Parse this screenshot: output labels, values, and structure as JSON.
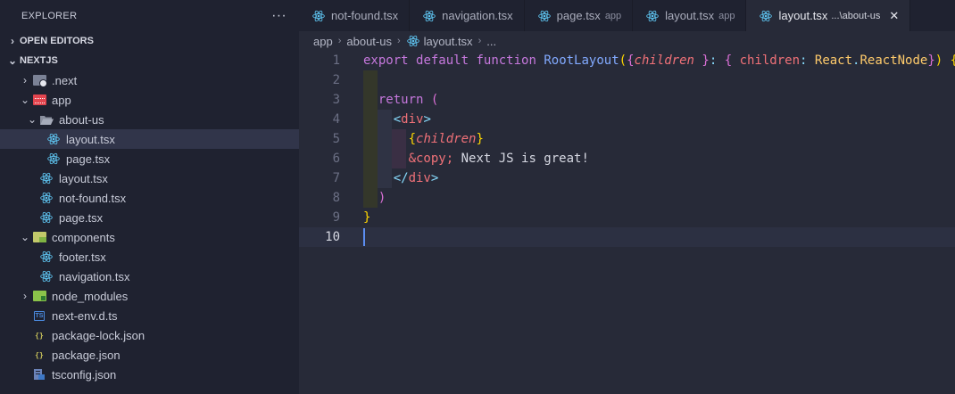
{
  "explorer": {
    "title": "EXPLORER",
    "more": "···",
    "open_editors": "OPEN EDITORS",
    "project": "NEXTJS",
    "tree": [
      {
        "label": ".next",
        "depth": 1,
        "kind": "folder-next",
        "chev": "›"
      },
      {
        "label": "app",
        "depth": 1,
        "kind": "folder-app",
        "chev": "⌄"
      },
      {
        "label": "about-us",
        "depth": 2,
        "kind": "folder-open",
        "chev": "⌄"
      },
      {
        "label": "layout.tsx",
        "depth": 3,
        "kind": "react",
        "selected": true
      },
      {
        "label": "page.tsx",
        "depth": 3,
        "kind": "react"
      },
      {
        "label": "layout.tsx",
        "depth": 2,
        "kind": "react"
      },
      {
        "label": "not-found.tsx",
        "depth": 2,
        "kind": "react"
      },
      {
        "label": "page.tsx",
        "depth": 2,
        "kind": "react"
      },
      {
        "label": "components",
        "depth": 1,
        "kind": "folder-comp",
        "chev": "⌄"
      },
      {
        "label": "footer.tsx",
        "depth": 2,
        "kind": "react"
      },
      {
        "label": "navigation.tsx",
        "depth": 2,
        "kind": "react"
      },
      {
        "label": "node_modules",
        "depth": 1,
        "kind": "folder-node",
        "chev": "›"
      },
      {
        "label": "next-env.d.ts",
        "depth": 1,
        "kind": "ts"
      },
      {
        "label": "package-lock.json",
        "depth": 1,
        "kind": "js"
      },
      {
        "label": "package.json",
        "depth": 1,
        "kind": "js"
      },
      {
        "label": "tsconfig.json",
        "depth": 1,
        "kind": "tsconfig"
      }
    ]
  },
  "tabs": [
    {
      "label": "not-found.tsx",
      "desc": ""
    },
    {
      "label": "navigation.tsx",
      "desc": ""
    },
    {
      "label": "page.tsx",
      "desc": "app"
    },
    {
      "label": "layout.tsx",
      "desc": "app"
    },
    {
      "label": "layout.tsx",
      "desc": "...\\about-us",
      "active": true
    }
  ],
  "close_glyph": "✕",
  "breadcrumb": {
    "items": [
      "app",
      "about-us",
      "layout.tsx",
      "..."
    ],
    "separator": "›"
  },
  "editor": {
    "line_numbers": [
      "1",
      "2",
      "3",
      "4",
      "5",
      "6",
      "7",
      "8",
      "9",
      "10"
    ],
    "current_line": 10,
    "lines": [
      [
        [
          "kw",
          "export"
        ],
        [
          "txt",
          " "
        ],
        [
          "kw",
          "default"
        ],
        [
          "txt",
          " "
        ],
        [
          "kw",
          "function"
        ],
        [
          "txt",
          " "
        ],
        [
          "fn",
          "RootLayout"
        ],
        [
          "brk1",
          "("
        ],
        [
          "brk2",
          "{"
        ],
        [
          "param",
          "children"
        ],
        [
          "txt",
          " "
        ],
        [
          "brk2",
          "}"
        ],
        [
          "punc",
          ":"
        ],
        [
          "txt",
          " "
        ],
        [
          "brk2",
          "{"
        ],
        [
          "txt",
          " "
        ],
        [
          "prop",
          "children"
        ],
        [
          "punc",
          ":"
        ],
        [
          "txt",
          " "
        ],
        [
          "type",
          "React"
        ],
        [
          "punc",
          "."
        ],
        [
          "type",
          "ReactNode"
        ],
        [
          "brk2",
          "}"
        ],
        [
          "brk1",
          ")"
        ],
        [
          "txt",
          " "
        ],
        [
          "brk1",
          "{"
        ]
      ],
      [],
      [
        [
          "txt",
          "  "
        ],
        [
          "kw",
          "return"
        ],
        [
          "txt",
          " "
        ],
        [
          "brk2",
          "("
        ]
      ],
      [
        [
          "txt",
          "    "
        ],
        [
          "tagp",
          "<"
        ],
        [
          "tag",
          "div"
        ],
        [
          "tagp",
          ">"
        ]
      ],
      [
        [
          "txt",
          "      "
        ],
        [
          "brk1",
          "{"
        ],
        [
          "param",
          "children"
        ],
        [
          "brk1",
          "}"
        ]
      ],
      [
        [
          "txt",
          "      "
        ],
        [
          "ent",
          "&copy;"
        ],
        [
          "txt",
          " Next JS is great!"
        ]
      ],
      [
        [
          "txt",
          "    "
        ],
        [
          "tagp",
          "</"
        ],
        [
          "tag",
          "div"
        ],
        [
          "tagp",
          ">"
        ]
      ],
      [
        [
          "txt",
          "  "
        ],
        [
          "brk2",
          ")"
        ]
      ],
      [
        [
          "brk1",
          "}"
        ]
      ],
      []
    ]
  }
}
